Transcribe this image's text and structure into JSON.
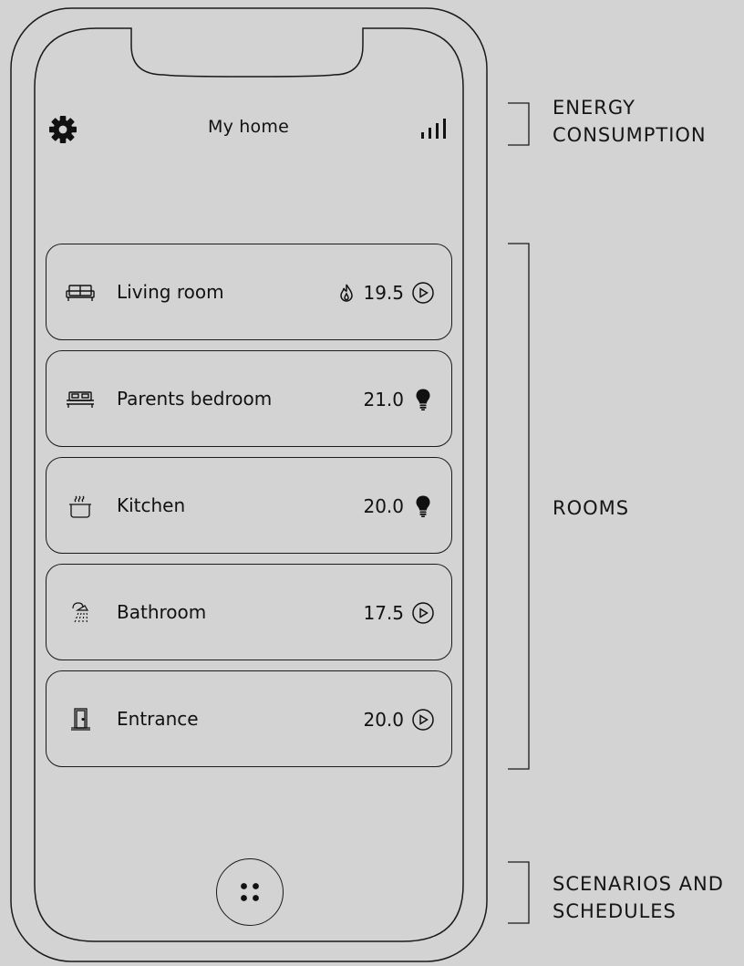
{
  "header": {
    "title": "My home",
    "settings_icon": "gear-icon",
    "energy_icon": "bar-chart-icon"
  },
  "rooms": [
    {
      "name": "Living room",
      "icon": "sofa-icon",
      "prefix_icon": "flame-icon",
      "temperature": "19.5",
      "status_icon": "play-circle-icon"
    },
    {
      "name": "Parents bedroom",
      "icon": "bed-icon",
      "temperature": "21.0",
      "status_icon": "lightbulb-icon"
    },
    {
      "name": "Kitchen",
      "icon": "cooking-pot-icon",
      "temperature": "20.0",
      "status_icon": "lightbulb-icon"
    },
    {
      "name": "Bathroom",
      "icon": "shower-icon",
      "temperature": "17.5",
      "status_icon": "play-circle-icon"
    },
    {
      "name": "Entrance",
      "icon": "door-icon",
      "temperature": "20.0",
      "status_icon": "play-circle-icon"
    }
  ],
  "bottom": {
    "menu_icon": "four-dots-icon"
  },
  "annotations": {
    "energy": [
      "ENERGY",
      "CONSUMPTION"
    ],
    "rooms": [
      "ROOMS"
    ],
    "scenarios": [
      "SCENARIOS AND",
      "SCHEDULES"
    ]
  },
  "colors": {
    "background": "#d3d3d3",
    "stroke": "#1a1a1a"
  }
}
